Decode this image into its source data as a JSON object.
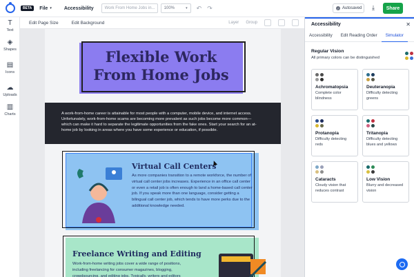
{
  "topbar": {
    "beta_badge": "BETA",
    "file_menu": "File",
    "accessibility_menu": "Accessibility",
    "doc_title": "Work From Home Jobs in...",
    "zoom": "100%",
    "autosaved": "Autosaved",
    "share": "Share"
  },
  "rail": {
    "items": [
      {
        "label": "Text",
        "icon": "text-icon"
      },
      {
        "label": "Shapes",
        "icon": "shapes-icon"
      },
      {
        "label": "Icons",
        "icon": "icons-icon"
      },
      {
        "label": "Uploads",
        "icon": "upload-icon"
      },
      {
        "label": "Charts",
        "icon": "chart-icon"
      }
    ]
  },
  "toolbar": {
    "edit_page_size": "Edit Page Size",
    "edit_background": "Edit Background",
    "layer": "Layer",
    "group": "Group"
  },
  "canvas": {
    "title_line1": "Flexible Work",
    "title_line2": "From Home Jobs",
    "intro": "A work-from-home career is attainable for most people with a computer, mobile device, and internet access. Unfortunately, work-from-home scams are becoming more prevalent as such jobs become more common—which can make it hard to separate the legitimate opportunities from the fake ones. Start your search for an at-home job by looking in areas where you have some experience or education, if possible.",
    "card1_heading": "Virtual Call Centers",
    "card1_body": "As more companies transition to a remote workforce, the number of virtual call center jobs increases. Experience in an office call center or even a retail job is often enough to land a home-based call center job. If you speak more than one language, consider getting a bilingual call center job, which tends to have more perks due to the additional knowledge needed.",
    "card2_heading": "Freelance Writing and Editing",
    "card2_body": "Work-from-home writing jobs cover a wide range of positions, including freelancing for consumer magazines, blogging, crowdsourcing, and editing jobs. Typically, writers and editors"
  },
  "panel": {
    "title": "Accessibility",
    "tabs": [
      "Accessibility",
      "Edit Reading Order",
      "Simulator"
    ],
    "active_tab": "Simulator",
    "regular_title": "Regular Vision",
    "regular_desc": "All primary colors can be distinguished",
    "cards": [
      {
        "name": "Achromatopsia",
        "desc": "Complete color blindness",
        "colors": [
          "#6b6b6b",
          "#4a4a4a",
          "#9a9a9a",
          "#2e2e2e"
        ]
      },
      {
        "name": "Deuteranopia",
        "desc": "Difficulty detecting greens",
        "colors": [
          "#2d6e8e",
          "#1d3d5e",
          "#c8a040",
          "#5a5a4a"
        ]
      },
      {
        "name": "Protanopia",
        "desc": "Difficulty detecting reds",
        "colors": [
          "#2d4e8e",
          "#1d2d5e",
          "#d8b830",
          "#6a6a4a"
        ]
      },
      {
        "name": "Tritanopia",
        "desc": "Difficulty detecting blues and yellows",
        "colors": [
          "#1a6b6b",
          "#c03040",
          "#d06080",
          "#2a4a4a"
        ]
      },
      {
        "name": "Cataracts",
        "desc": "Cloudy vision that reduces contrast",
        "colors": [
          "#7fa8c8",
          "#9aa0b8",
          "#d8c080",
          "#8e8e8e"
        ]
      },
      {
        "name": "Low Vision",
        "desc": "Blurry and decreased vision",
        "colors": [
          "#1a6b6b",
          "#2e8b57",
          "#d8c040",
          "#3a3a3a"
        ]
      }
    ]
  }
}
